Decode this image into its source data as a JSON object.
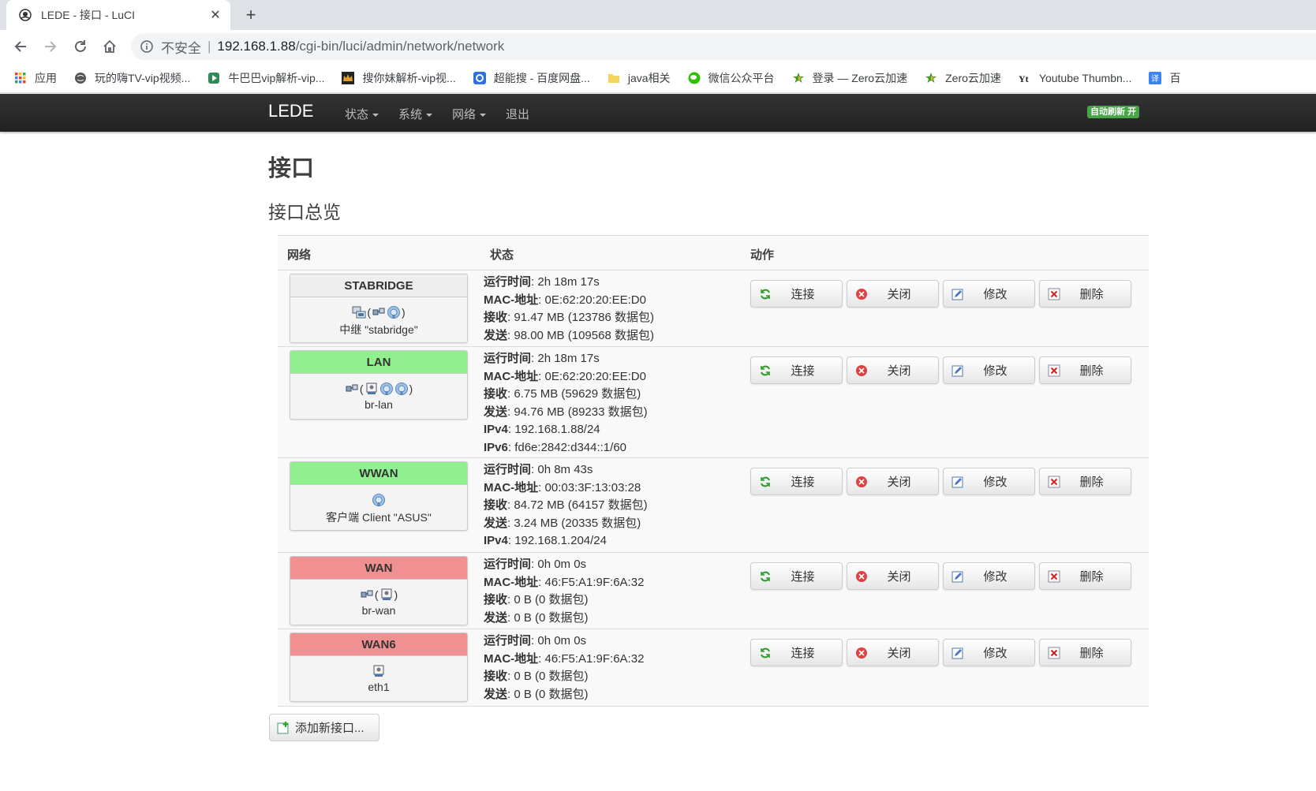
{
  "browser": {
    "tab_title": "LEDE - 接口 - LuCI",
    "tab_close": "✕",
    "new_tab": "+",
    "insecure_label": "不安全",
    "separator": "|",
    "url_host": "192.168.1.88",
    "url_path": "/cgi-bin/luci/admin/network/network"
  },
  "bookmarks": [
    {
      "label": "应用",
      "icon": "apps-grid-icon"
    },
    {
      "label": "玩的嗨TV-vip视频...",
      "icon": "globe-icon"
    },
    {
      "label": "牛巴巴vip解析-vip...",
      "icon": "play-icon"
    },
    {
      "label": "搜你妹解析-vip视...",
      "icon": "crown-icon"
    },
    {
      "label": "超能搜 - 百度网盘...",
      "icon": "search-icon"
    },
    {
      "label": "java相关",
      "icon": "folder-icon"
    },
    {
      "label": "微信公众平台",
      "icon": "wechat-icon"
    },
    {
      "label": "登录 — Zero云加速",
      "icon": "star-icon"
    },
    {
      "label": "Zero云加速",
      "icon": "star-icon"
    },
    {
      "label": "Youtube Thumbn...",
      "icon": "ytt-icon"
    },
    {
      "label": "百",
      "icon": "translate-icon"
    }
  ],
  "luci": {
    "brand": "LEDE",
    "menu": [
      "状态",
      "系统",
      "网络",
      "退出"
    ],
    "auto_refresh": "自动刷新 开"
  },
  "page": {
    "title": "接口",
    "section": "接口总览",
    "columns": [
      "网络",
      "状态",
      "动作"
    ]
  },
  "labels": {
    "uptime": "运行时间",
    "mac": "MAC-地址",
    "rx": "接收",
    "tx": "发送",
    "ipv4": "IPv4",
    "ipv6": "IPv6"
  },
  "actions": [
    "连接",
    "关闭",
    "修改",
    "删除"
  ],
  "interfaces": [
    {
      "name": "STABRIDGE",
      "color": "#eeeeee",
      "sub": "中继 \"stabridge\"",
      "uptime": "2h 18m 17s",
      "mac": "0E:62:20:20:EE:D0",
      "rx": "91.47 MB (123786 数据包)",
      "tx": "98.00 MB (109568 数据包)",
      "ipv4": null,
      "ipv6": null
    },
    {
      "name": "LAN",
      "color": "#90f090",
      "sub": "br-lan",
      "uptime": "2h 18m 17s",
      "mac": "0E:62:20:20:EE:D0",
      "rx": "6.75 MB (59629 数据包)",
      "tx": "94.76 MB (89233 数据包)",
      "ipv4": "192.168.1.88/24",
      "ipv6": "fd6e:2842:d344::1/60"
    },
    {
      "name": "WWAN",
      "color": "#90f090",
      "sub": "客户端 Client \"ASUS\"",
      "uptime": "0h 8m 43s",
      "mac": "00:03:3F:13:03:28",
      "rx": "84.72 MB (64157 数据包)",
      "tx": "3.24 MB (20335 数据包)",
      "ipv4": "192.168.1.204/24",
      "ipv6": null
    },
    {
      "name": "WAN",
      "color": "#f09090",
      "sub": "br-wan",
      "uptime": "0h 0m 0s",
      "mac": "46:F5:A1:9F:6A:32",
      "rx": "0 B (0 数据包)",
      "tx": "0 B (0 数据包)",
      "ipv4": null,
      "ipv6": null
    },
    {
      "name": "WAN6",
      "color": "#f09090",
      "sub": "eth1",
      "uptime": "0h 0m 0s",
      "mac": "46:F5:A1:9F:6A:32",
      "rx": "0 B (0 数据包)",
      "tx": "0 B (0 数据包)",
      "ipv4": null,
      "ipv6": null
    }
  ],
  "add_interface": "添加新接口..."
}
